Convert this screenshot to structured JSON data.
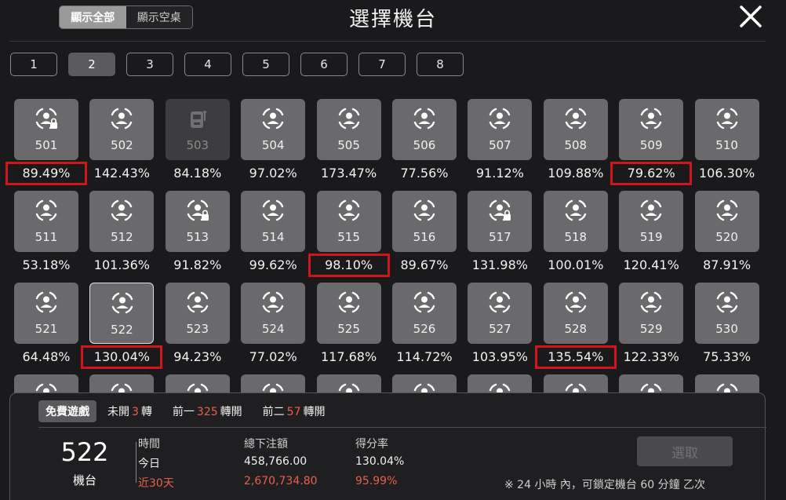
{
  "header": {
    "show_all_label": "顯示全部",
    "show_empty_label": "顯示空桌",
    "title": "選擇機台"
  },
  "tabs": [
    {
      "label": "1",
      "active": false
    },
    {
      "label": "2",
      "active": true
    },
    {
      "label": "3",
      "active": false
    },
    {
      "label": "4",
      "active": false
    },
    {
      "label": "5",
      "active": false
    },
    {
      "label": "6",
      "active": false
    },
    {
      "label": "7",
      "active": false
    },
    {
      "label": "8",
      "active": false
    }
  ],
  "machines": [
    {
      "num": "501",
      "rate": "89.49%",
      "state": "locked",
      "highlight": true
    },
    {
      "num": "502",
      "rate": "142.43%",
      "state": "normal",
      "highlight": false
    },
    {
      "num": "503",
      "rate": "84.18%",
      "state": "disabled",
      "highlight": false
    },
    {
      "num": "504",
      "rate": "97.02%",
      "state": "normal",
      "highlight": false
    },
    {
      "num": "505",
      "rate": "173.47%",
      "state": "normal",
      "highlight": false
    },
    {
      "num": "506",
      "rate": "77.56%",
      "state": "normal",
      "highlight": false
    },
    {
      "num": "507",
      "rate": "91.12%",
      "state": "normal",
      "highlight": false
    },
    {
      "num": "508",
      "rate": "109.88%",
      "state": "normal",
      "highlight": false
    },
    {
      "num": "509",
      "rate": "79.62%",
      "state": "normal",
      "highlight": true
    },
    {
      "num": "510",
      "rate": "106.30%",
      "state": "normal",
      "highlight": false
    },
    {
      "num": "511",
      "rate": "53.18%",
      "state": "normal",
      "highlight": false
    },
    {
      "num": "512",
      "rate": "101.36%",
      "state": "normal",
      "highlight": false
    },
    {
      "num": "513",
      "rate": "91.82%",
      "state": "locked",
      "highlight": false
    },
    {
      "num": "514",
      "rate": "99.62%",
      "state": "normal",
      "highlight": false
    },
    {
      "num": "515",
      "rate": "98.10%",
      "state": "normal",
      "highlight": true
    },
    {
      "num": "516",
      "rate": "89.67%",
      "state": "normal",
      "highlight": false
    },
    {
      "num": "517",
      "rate": "131.98%",
      "state": "locked",
      "highlight": false
    },
    {
      "num": "518",
      "rate": "100.01%",
      "state": "normal",
      "highlight": false
    },
    {
      "num": "519",
      "rate": "120.41%",
      "state": "normal",
      "highlight": false
    },
    {
      "num": "520",
      "rate": "87.91%",
      "state": "normal",
      "highlight": false
    },
    {
      "num": "521",
      "rate": "64.48%",
      "state": "normal",
      "highlight": false
    },
    {
      "num": "522",
      "rate": "130.04%",
      "state": "selected",
      "highlight": true
    },
    {
      "num": "523",
      "rate": "94.23%",
      "state": "normal",
      "highlight": false
    },
    {
      "num": "524",
      "rate": "77.02%",
      "state": "normal",
      "highlight": false
    },
    {
      "num": "525",
      "rate": "117.68%",
      "state": "normal",
      "highlight": false
    },
    {
      "num": "526",
      "rate": "114.72%",
      "state": "normal",
      "highlight": false
    },
    {
      "num": "527",
      "rate": "103.95%",
      "state": "normal",
      "highlight": false
    },
    {
      "num": "528",
      "rate": "135.54%",
      "state": "normal",
      "highlight": true
    },
    {
      "num": "529",
      "rate": "122.33%",
      "state": "normal",
      "highlight": false
    },
    {
      "num": "530",
      "rate": "75.33%",
      "state": "normal",
      "highlight": false
    }
  ],
  "info": {
    "free_game_label": "免費遊戲",
    "unopened_prefix": "未開",
    "unopened_count": "3",
    "unopened_suffix": "轉",
    "prev1_prefix": "前一",
    "prev1_count": "325",
    "prev1_suffix": "轉開",
    "prev2_prefix": "前二",
    "prev2_count": "57",
    "prev2_suffix": "轉開",
    "machine_number": "522",
    "machine_label": "機台",
    "col_time": "時間",
    "col_bet": "總下注額",
    "col_rate": "得分率",
    "today_label": "今日",
    "today_bet": "458,766.00",
    "today_rate": "130.04%",
    "month_label": "近30天",
    "month_bet": "2,670,734.80",
    "month_rate": "95.99%",
    "select_label": "選取",
    "lock_note": "※ 24 小時 內，可鎖定機台 60 分鐘 乙次"
  },
  "colors": {
    "highlight_box": "#d0161b",
    "accent_orange": "#e8604a"
  }
}
